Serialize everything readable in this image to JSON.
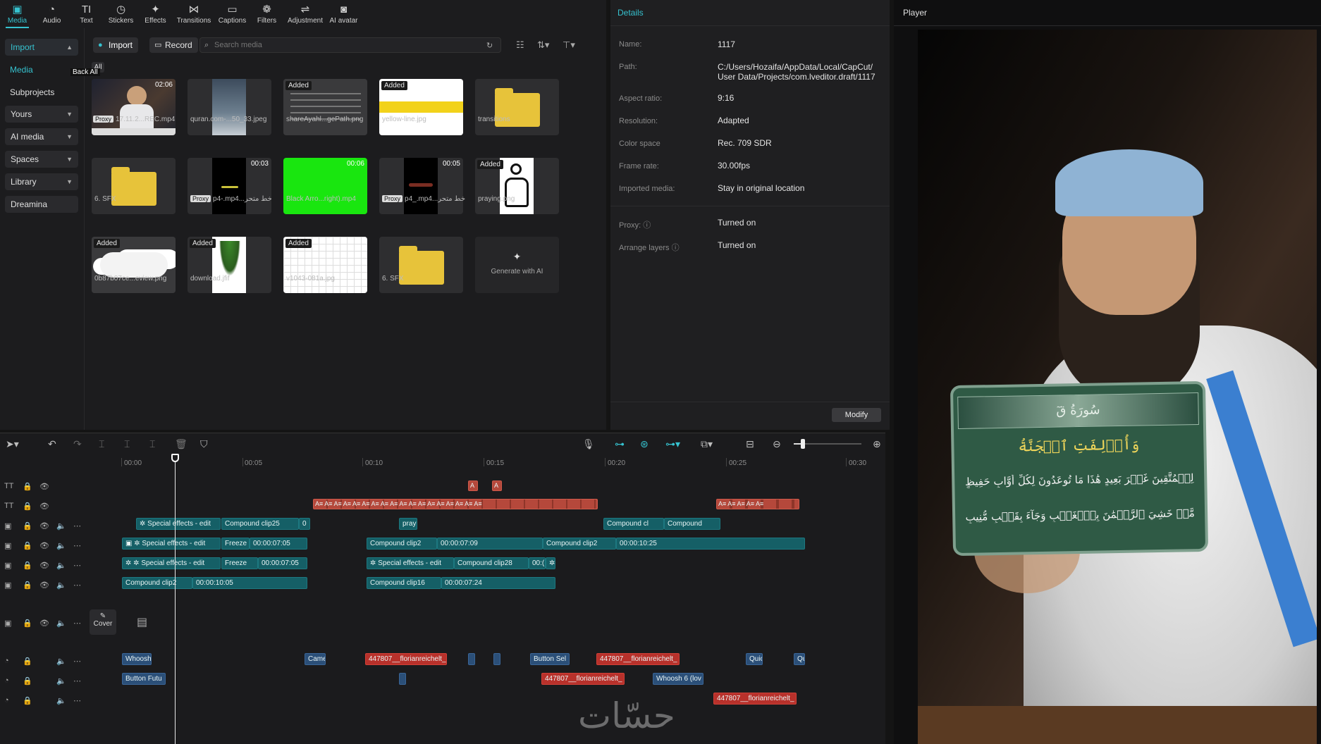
{
  "toolbar": {
    "items": [
      {
        "label": "Media",
        "icon": "media-icon",
        "active": true
      },
      {
        "label": "Audio",
        "icon": "audio-icon"
      },
      {
        "label": "Text",
        "icon": "text-icon"
      },
      {
        "label": "Stickers",
        "icon": "stickers-icon"
      },
      {
        "label": "Effects",
        "icon": "effects-icon"
      },
      {
        "label": "Transitions",
        "icon": "transitions-icon"
      },
      {
        "label": "Captions",
        "icon": "captions-icon"
      },
      {
        "label": "Filters",
        "icon": "filters-icon"
      },
      {
        "label": "Adjustment",
        "icon": "adjustment-icon"
      },
      {
        "label": "AI avatar",
        "icon": "ai-avatar-icon"
      }
    ]
  },
  "leftnav": {
    "import": "Import",
    "media": "Media",
    "subprojects": "Subprojects",
    "yours": "Yours",
    "ai_media": "AI media",
    "spaces": "Spaces",
    "library": "Library",
    "dreamina": "Dreamina"
  },
  "media": {
    "import_btn": "Import",
    "record_btn": "Record",
    "search_placeholder": "Search media",
    "filter_all": "All",
    "back_all": "Back All",
    "items": [
      {
        "name": "17.11.2...REC.mp4",
        "duration": "02:06",
        "proxy": "Proxy"
      },
      {
        "name": "quran.com-...50_33.jpeg"
      },
      {
        "name": "shareAyahl...gePath.png",
        "tag": "Added"
      },
      {
        "name": "yellow-line.jpg",
        "tag": "Added"
      },
      {
        "name": "transitions"
      },
      {
        "name": "6. SFX"
      },
      {
        "name": "p4-.mp4...خط متحر",
        "duration": "00:03",
        "proxy": "Proxy"
      },
      {
        "name": "Black Arro...right).mp4",
        "duration": "00:06"
      },
      {
        "name": "p4_.mp4...خط متحر",
        "duration": "00:05",
        "proxy": "Proxy"
      },
      {
        "name": "praying.png",
        "tag": "Added"
      },
      {
        "name": "0b87b07ce...eview.png",
        "tag": "Added"
      },
      {
        "name": "download.jfif",
        "tag": "Added"
      },
      {
        "name": "v1043-081a.jpg",
        "tag": "Added"
      },
      {
        "name": "6. SFX"
      },
      {
        "name": "Generate with AI"
      }
    ]
  },
  "details": {
    "title": "Details",
    "rows": [
      {
        "label": "Name:",
        "value": "1117"
      },
      {
        "label": "Path:",
        "value": "C:/Users/Hozaifa/AppData/Local/CapCut/ User Data/Projects/com.lveditor.draft/1117"
      },
      {
        "label": "Aspect ratio:",
        "value": "9:16"
      },
      {
        "label": "Resolution:",
        "value": "Adapted"
      },
      {
        "label": "Color space",
        "value": "Rec. 709 SDR"
      },
      {
        "label": "Frame rate:",
        "value": "30.00fps"
      },
      {
        "label": "Imported media:",
        "value": "Stay in original location"
      },
      {
        "label": "Proxy:",
        "value": "Turned on"
      },
      {
        "label": "Arrange layers",
        "value": "Turned on"
      }
    ],
    "modify": "Modify"
  },
  "player": {
    "title": "Player",
    "surah": "سُورَةُ قٓ",
    "verse1": "وَأُزۡلِفَتِ ٱلۡجَنَّةُ",
    "verse2": "لِلۡمُتَّقِينَ غَيۡرَ بَعِيدٍ هَٰذَا مَا تُوعَدُونَ لِكُلِّ أَوَّابٍ حَفِيظٍ",
    "verse3": "مَّنۡ خَشِيَ ٱلرَّحۡمَٰنَ بِٱلۡغَيۡبِ وَجَآءَ بِقَلۡبٍ مُّنِيبٍ"
  },
  "timeline": {
    "ticks": [
      "00:00",
      "00:05",
      "00:10",
      "00:15",
      "00:20",
      "00:25",
      "00:30"
    ],
    "cover": "Cover",
    "watermark": "حسّات",
    "clips": {
      "fx1": "Special effects - edit",
      "cc25": "Compound clip25",
      "zero": "0",
      "pray": "pray",
      "ccA": "Compound cl",
      "ccB": "Compound",
      "fx2": "Special effects - edit",
      "freeze1": "Freeze",
      "t705a": "00:00:07:05",
      "cc2a": "Compound clip2",
      "t709": "00:00:07:09",
      "cc2b": "Compound clip2",
      "t1025a": "00:00:10:25",
      "fx3": "Special effects - edit",
      "freeze2": "Freeze",
      "t705b": "00:00:07:05",
      "fx4": "Special effects - edit",
      "cc28": "Compound clip28",
      "t00": "00:(",
      "cc2c": "Compound clip2",
      "t1025b": "00:00:10:05",
      "cc16": "Compound clip16",
      "t724": "00:00:07:24",
      "whoosh": "Whoosh",
      "came": "Came",
      "flo1": "447807__florianreichelt_",
      "btnsel": "Button Sel",
      "flo2": "447807__florianreichelt_",
      "quic": "Quic",
      "qu": "Qu",
      "btnfutu": "Button Futu",
      "flo3": "447807__florianreichelt_",
      "whoosh6": "Whoosh 6 (lov",
      "flo4": "447807__florianreichelt_"
    }
  }
}
